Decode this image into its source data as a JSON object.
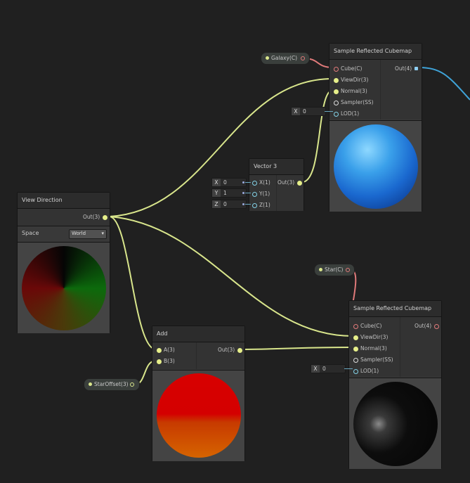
{
  "nodes": {
    "cubemap_top": {
      "title": "Sample Reflected Cubemap",
      "inputs": [
        "Cube(C)",
        "ViewDir(3)",
        "Normal(3)",
        "Sampler(SS)",
        "LOD(1)"
      ],
      "output": "Out(4)",
      "lod_field": {
        "axis": "X",
        "value": "0"
      }
    },
    "cubemap_bottom": {
      "title": "Sample Reflected Cubemap",
      "inputs": [
        "Cube(C)",
        "ViewDir(3)",
        "Normal(3)",
        "Sampler(SS)",
        "LOD(1)"
      ],
      "output": "Out(4)",
      "lod_field": {
        "axis": "X",
        "value": "0"
      }
    },
    "vector3": {
      "title": "Vector 3",
      "inputs": [
        "X(1)",
        "Y(1)",
        "Z(1)"
      ],
      "output": "Out(3)",
      "fields": [
        {
          "axis": "X",
          "value": "0"
        },
        {
          "axis": "Y",
          "value": "1"
        },
        {
          "axis": "Z",
          "value": "0"
        }
      ]
    },
    "view_direction": {
      "title": "View Direction",
      "output": "Out(3)",
      "space_label": "Space",
      "space_value": "World"
    },
    "add": {
      "title": "Add",
      "inputs": [
        "A(3)",
        "B(3)"
      ],
      "output": "Out(3)"
    }
  },
  "properties": {
    "galaxy": "Galaxy(C)",
    "star": "Star(C)",
    "star_offset": "StarOffset(3)"
  },
  "colors": {
    "background": "#202020",
    "vector_wire": "#d9e68c",
    "cubemap_wire": "#e07a7a",
    "vector4_wire": "#3fa3d8",
    "float_port": "#84d3e8"
  }
}
